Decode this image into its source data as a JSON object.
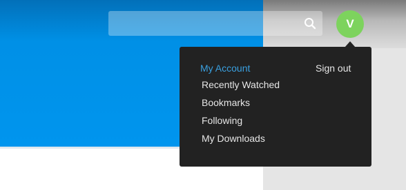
{
  "header": {
    "search": {
      "placeholder": "",
      "value": "",
      "icon": "search-icon"
    },
    "avatar": {
      "initial": "V",
      "color": "#7dd35d"
    }
  },
  "account_menu": {
    "active_item": "My Account",
    "items": [
      {
        "label": "My Account"
      },
      {
        "label": "Recently Watched"
      },
      {
        "label": "Bookmarks"
      },
      {
        "label": "Following"
      },
      {
        "label": "My Downloads"
      }
    ],
    "sign_out_label": "Sign out"
  },
  "colors": {
    "hero_blue": "#0095ee",
    "menu_background": "#222222",
    "active_link": "#3aa0e0",
    "menu_text": "#e6e6e6"
  }
}
